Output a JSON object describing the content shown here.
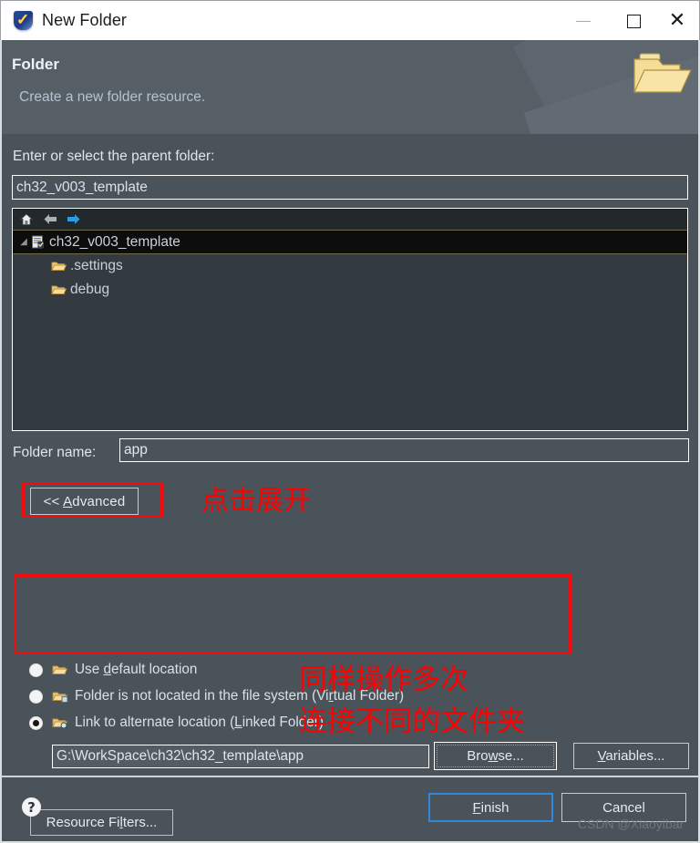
{
  "window": {
    "title": "New Folder",
    "icon": "mounriver-shield-icon",
    "minimize_label": "—",
    "maximize_label": "□",
    "close_label": "✕"
  },
  "header": {
    "title": "Folder",
    "subtitle": "Create a new folder resource.",
    "icon": "open-folder-icon"
  },
  "parent": {
    "label": "Enter or select the parent folder:",
    "value": "ch32_v003_template",
    "placeholder": ""
  },
  "tree": {
    "toolbar": [
      {
        "name": "home-icon",
        "glyph": "⌂"
      },
      {
        "name": "back-arrow-icon",
        "glyph": "←"
      },
      {
        "name": "forward-arrow-icon",
        "glyph": "→"
      }
    ],
    "items": [
      {
        "label": "ch32_v003_template",
        "icon": "project-icon",
        "selected": true,
        "expanded": true,
        "depth": 0
      },
      {
        "label": ".settings",
        "icon": "folder-icon",
        "selected": false,
        "depth": 1
      },
      {
        "label": "debug",
        "icon": "folder-icon",
        "selected": false,
        "depth": 1
      }
    ]
  },
  "folder_name": {
    "label": "Folder name:",
    "value": "app"
  },
  "advanced": {
    "button_prefix": "<< ",
    "button_mnemonic": "A",
    "button_rest": "dvanced",
    "options": [
      {
        "id": "use-default-location",
        "pre": "Use ",
        "mnemonic": "d",
        "post": "efault location",
        "selected": false,
        "icon": "folder-icon"
      },
      {
        "id": "virtual-folder",
        "pre": "Folder is not located in the file system (Vi",
        "mnemonic": "r",
        "post": "tual Folder)",
        "selected": false,
        "icon": "virtual-folder-icon"
      },
      {
        "id": "linked-folder",
        "pre": "Link to alternate location (",
        "mnemonic": "L",
        "post": "inked Folder)",
        "selected": true,
        "icon": "linked-folder-icon"
      }
    ],
    "link_path": "G:\\WorkSpace\\ch32\\ch32_template\\app",
    "browse": {
      "pre": "Bro",
      "mnemonic": "w",
      "post": "se..."
    },
    "variables": {
      "pre": "",
      "mnemonic": "V",
      "post": "ariables..."
    },
    "resource_filters": {
      "pre": "Resource Fi",
      "mnemonic": "l",
      "post": "ters..."
    }
  },
  "annotations": [
    {
      "id": "annotation-click-expand",
      "text": "点击展开"
    },
    {
      "id": "annotation-repeat-operation",
      "text": "同样操作多次"
    },
    {
      "id": "annotation-link-different-folders",
      "text": "连接不同的文件夹"
    }
  ],
  "footer": {
    "help_label": "?",
    "finish": {
      "mnemonic": "F",
      "post": "inish"
    },
    "cancel_label": "Cancel",
    "watermark": "CSDN @Xiaoyibar"
  },
  "colors": {
    "dialog_bg": "#4b535a",
    "header_bg": "#575f66",
    "tree_bg": "#333a40",
    "annotation_red": "#ff0000",
    "focus_blue": "#2e8ad8",
    "text": "#dfe5ea"
  }
}
